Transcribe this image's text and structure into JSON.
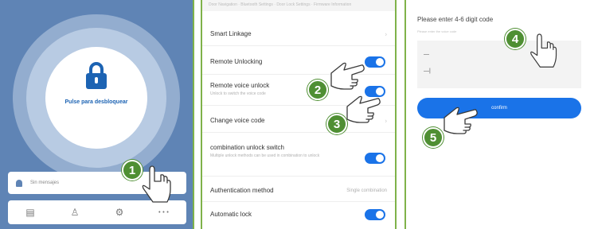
{
  "panel1": {
    "unlock_button_label": "Pulse para desbloquear",
    "messages_placeholder": "Sin mensajes",
    "nav": [
      {
        "icon": "document-icon",
        "glyph": "▤"
      },
      {
        "icon": "user-icon",
        "glyph": "♙"
      },
      {
        "icon": "settings-icon",
        "glyph": "⚙"
      },
      {
        "icon": "more-icon",
        "glyph": "•••"
      }
    ]
  },
  "panel2": {
    "top_strip_text": "Door Navigation · Bluetooth Settings · Door Lock Settings · Firmware Information",
    "rows": [
      {
        "label": "Smart Linkage",
        "type": "chevron"
      },
      {
        "label": "Remote Unlocking",
        "type": "toggle",
        "on": true
      },
      {
        "label": "Remote voice unlock",
        "sub": "Unlock to switch the voice code",
        "type": "toggle",
        "on": true
      },
      {
        "label": "Change voice code",
        "type": "chevron"
      },
      {
        "label": "combination unlock switch",
        "sub": "Multiple unlock methods can be used in combination to unlock",
        "type": "toggle",
        "on": true
      },
      {
        "label": "Authentication method",
        "value": "Single combination",
        "type": "value"
      },
      {
        "label": "Automatic lock",
        "type": "toggle",
        "on": true
      }
    ]
  },
  "panel3": {
    "title": "Please enter 4-6 digit code",
    "subtitle": "Please enter the voice code",
    "field1": "—",
    "field2": "—|",
    "confirm_label": "confirm"
  },
  "steps": [
    "1",
    "2",
    "3",
    "4",
    "5"
  ],
  "colors": {
    "accent_blue": "#1a73e8",
    "app_background": "#5f84b5",
    "step_badge": "#4f8f33",
    "panel_border": "#7fb24a"
  }
}
